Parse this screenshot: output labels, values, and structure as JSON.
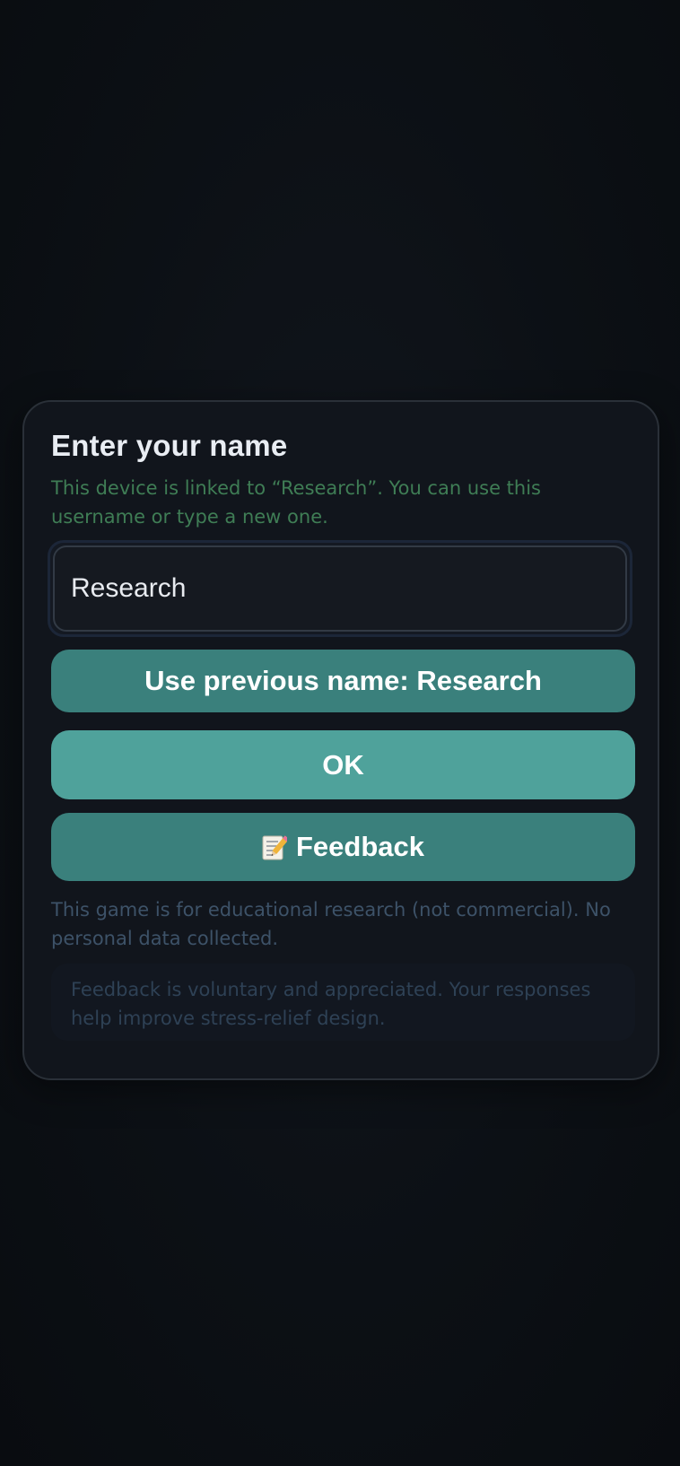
{
  "dialog": {
    "title": "Enter your name",
    "subtitle": "This device is linked to “Research”. You can use this username or type a new one."
  },
  "name_input": {
    "value": "Research"
  },
  "buttons": {
    "use_previous_label": "Use previous name: Research",
    "ok_label": "OK",
    "feedback_label": "Feedback",
    "feedback_icon": "memo-icon"
  },
  "notice": "This game is for educational research (not commercial). No personal data collected.",
  "feedback_note": "Feedback is voluntary and appreciated. Your responses help improve stress-relief design.",
  "colors": {
    "background": "#0c1015",
    "card": "#11151c",
    "accent_primary": "#4fa29b",
    "accent_secondary": "#3a807c",
    "subtitle_green": "#3f7d55",
    "muted_text": "#3d5268"
  }
}
